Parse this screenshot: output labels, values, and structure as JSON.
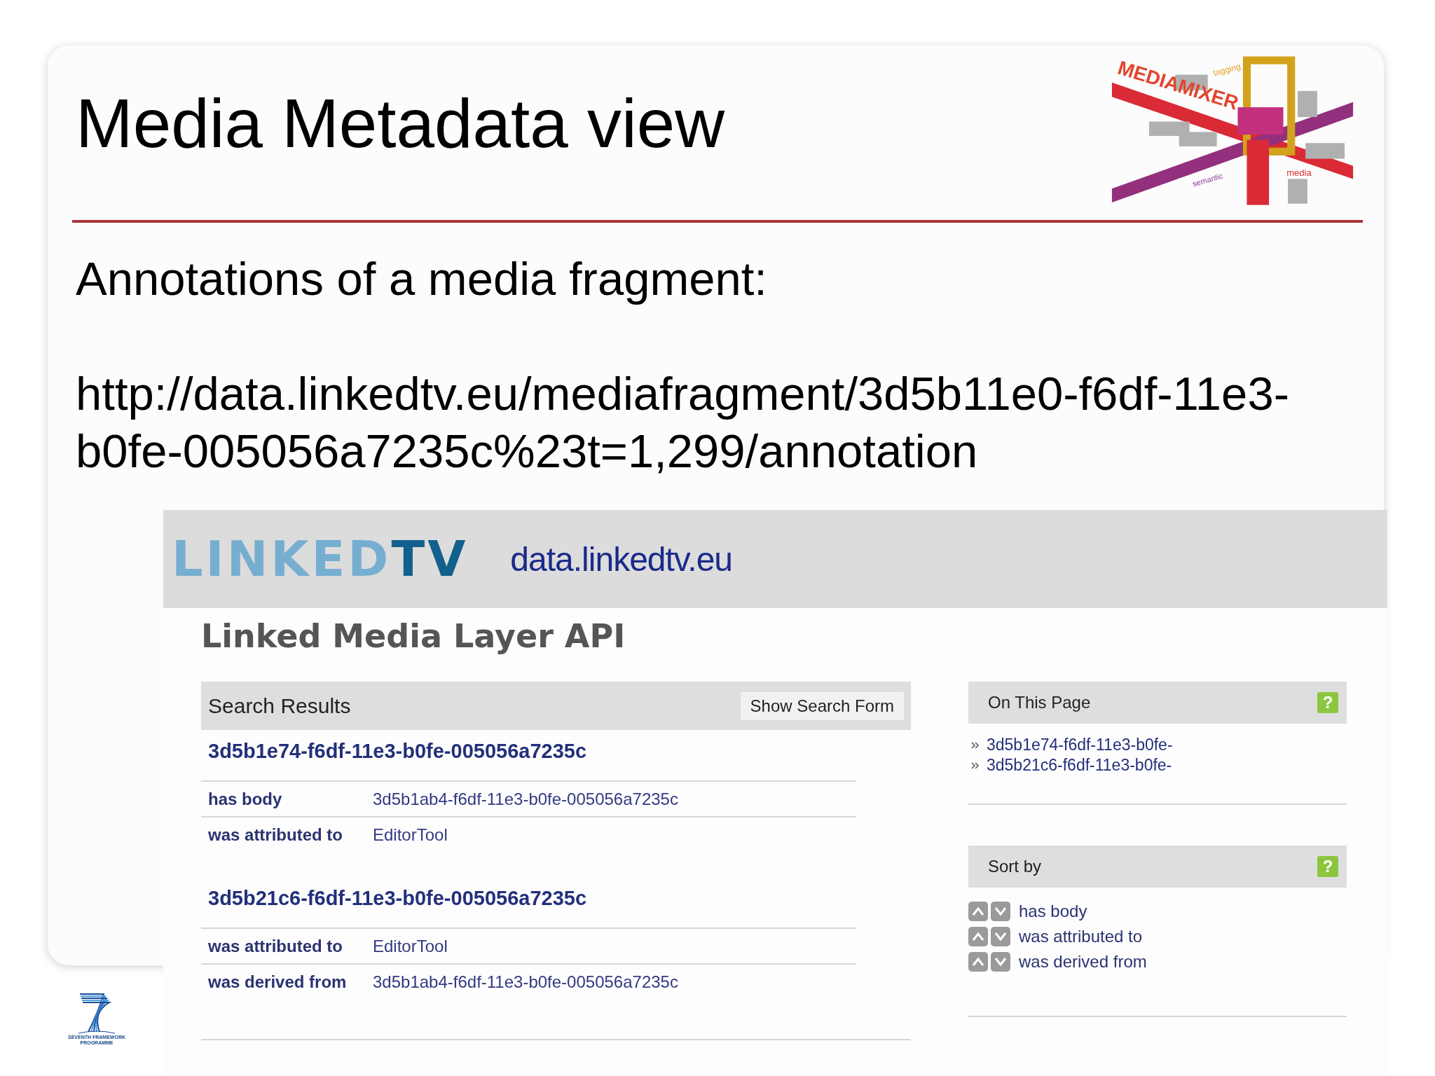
{
  "slide": {
    "title": "Media Metadata view",
    "logo_words": [
      {
        "text": "MEDIAMIXER",
        "kind": "brand"
      },
      {
        "text": "tagging",
        "kind": "tag"
      },
      {
        "text": "semantic",
        "kind": "semantic"
      },
      {
        "text": "media",
        "kind": "media"
      }
    ],
    "subtitle": "Annotations of a media fragment:",
    "url": "http://data.linkedtv.eu/mediafragment/3d5b11e0-f6df-11e3-b0fe-005056a7235c%23t=1,299/annotation",
    "footer_logo": [
      "SEVENTH FRAMEWORK",
      "PROGRAMME"
    ]
  },
  "embedded_page": {
    "site_logo": {
      "light": "LINKED",
      "dark": "TV"
    },
    "domain": "data.linkedtv.eu",
    "heading": "Linked Media Layer API",
    "search_results": {
      "title": "Search Results",
      "button": "Show Search Form",
      "results": [
        {
          "id": "3d5b1e74-f6df-11e3-b0fe-005056a7235c",
          "properties": [
            {
              "label": "has body",
              "value": "3d5b1ab4-f6df-11e3-b0fe-005056a7235c"
            },
            {
              "label": "was attributed to",
              "value": "EditorTool"
            }
          ]
        },
        {
          "id": "3d5b21c6-f6df-11e3-b0fe-005056a7235c",
          "properties": [
            {
              "label": "was attributed to",
              "value": "EditorTool"
            },
            {
              "label": "was derived from",
              "value": "3d5b1ab4-f6df-11e3-b0fe-005056a7235c"
            }
          ]
        }
      ]
    },
    "on_this_page": {
      "title": "On This Page",
      "help": "?",
      "links": [
        "3d5b1e74-f6df-11e3-b0fe-",
        "3d5b21c6-f6df-11e3-b0fe-"
      ]
    },
    "sort_by": {
      "title": "Sort by",
      "help": "?",
      "fields": [
        "has body",
        "was attributed to",
        "was derived from"
      ]
    }
  }
}
